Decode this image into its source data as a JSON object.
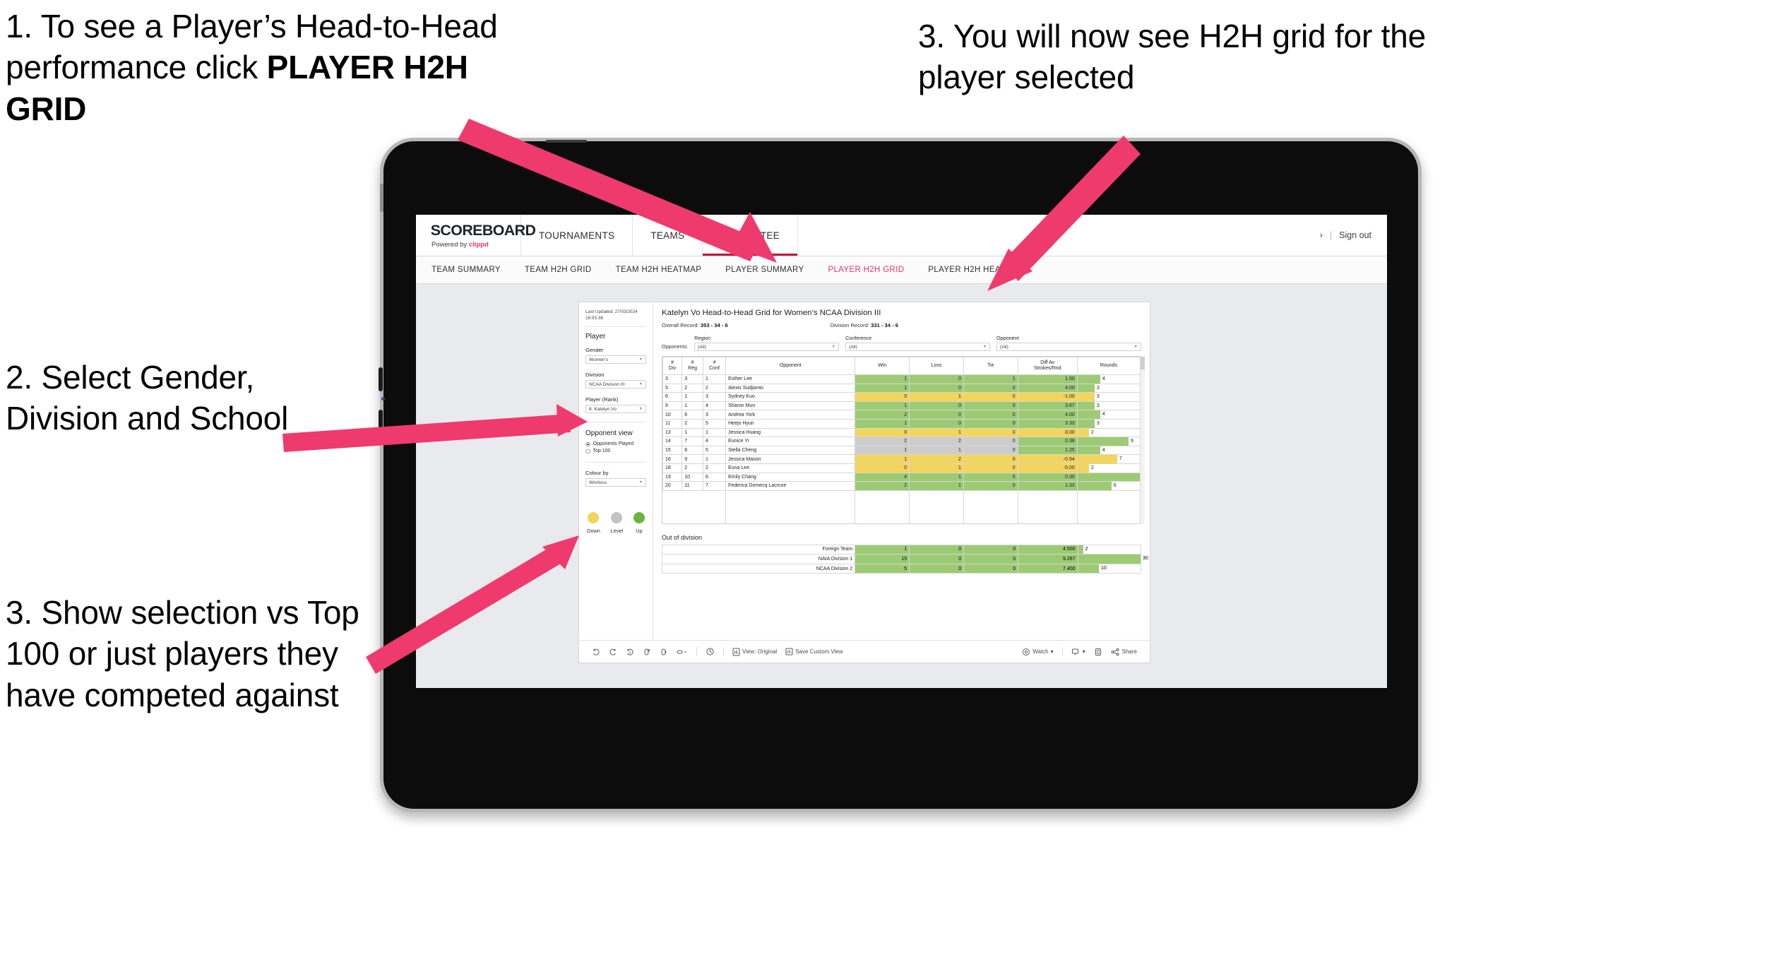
{
  "annotations": [
    {
      "id": "anno-1",
      "text_plain": "1. To see a Player’s Head-to-Head performance click ",
      "text_bold": "PLAYER H2H GRID"
    },
    {
      "id": "anno-2",
      "text": "2. Select Gender, Division and School"
    },
    {
      "id": "anno-3",
      "text": "3. Show selection vs Top 100 or just players they have competed against"
    },
    {
      "id": "anno-4",
      "text": "3. You will now see H2H grid for the player selected"
    }
  ],
  "colors": {
    "accent_pink": "#e8336d",
    "arrow_pink": "#ef3a6e",
    "win_green": "#9ccb74",
    "loss_yellow": "#f3d55b",
    "level_grey": "#cccccc",
    "active_tab_underline": "#c0143c"
  },
  "header": {
    "brand": "SCOREBOARD",
    "brand_sub_prefix": "Powered by ",
    "brand_sub_accent": "clippd",
    "nav": [
      {
        "label": "TOURNAMENTS",
        "active": false
      },
      {
        "label": "TEAMS",
        "active": false
      },
      {
        "label": "COMMITTEE",
        "active": true
      }
    ],
    "account_chevron": "›",
    "separator": "|",
    "sign_out": "Sign out"
  },
  "subnav": [
    {
      "label": "TEAM SUMMARY",
      "active": false
    },
    {
      "label": "TEAM H2H GRID",
      "active": false
    },
    {
      "label": "TEAM H2H HEATMAP",
      "active": false
    },
    {
      "label": "PLAYER SUMMARY",
      "active": false
    },
    {
      "label": "PLAYER H2H GRID",
      "active": true
    },
    {
      "label": "PLAYER H2H HEATMAP",
      "active": false
    }
  ],
  "sidebar": {
    "last_updated": "Last Updated: 27/03/2024 16:55:38",
    "section_player": "Player",
    "filters": [
      {
        "label": "Gender",
        "value": "Women's"
      },
      {
        "label": "Division",
        "value": "NCAA Division III"
      },
      {
        "label": "Player (Rank)",
        "value": "8. Katelyn Vo"
      }
    ],
    "opponent_view": {
      "title": "Opponent view",
      "options": [
        {
          "label": "Opponents Played",
          "selected": true
        },
        {
          "label": "Top 100",
          "selected": false
        }
      ]
    },
    "colour_by": {
      "label": "Colour by",
      "value": "Win/loss"
    },
    "legend": [
      {
        "label": "Down",
        "color": "#f3d55b"
      },
      {
        "label": "Level",
        "color": "#c2c2c2"
      },
      {
        "label": "Up",
        "color": "#6db33f"
      }
    ]
  },
  "main": {
    "title": "Katelyn Vo Head-to-Head Grid for Women’s NCAA Division III",
    "overall_record_label": "Overall Record: ",
    "overall_record_value": "353 -  34 - 6",
    "division_record_label": "Division Record: ",
    "division_record_value": "331 -  34 - 6",
    "opponents_label": "Opponents:",
    "opponent_filters": [
      {
        "label": "Region",
        "value": "(All)"
      },
      {
        "label": "Conference",
        "value": "(All)"
      },
      {
        "label": "Opponent",
        "value": "(All)"
      }
    ],
    "out_of_division_title": "Out of division"
  },
  "chart_data": {
    "type": "table",
    "title": "Katelyn Vo Head-to-Head Grid for Women’s NCAA Division III",
    "columns": [
      "# Div",
      "# Reg",
      "# Conf",
      "Opponent",
      "Win",
      "Loss",
      "Tie",
      "Diff Av Strokes/Rnd",
      "Rounds"
    ],
    "column_header_lines": [
      [
        "#",
        "Div"
      ],
      [
        "#",
        "Reg"
      ],
      [
        "#",
        "Conf"
      ],
      [
        "Opponent"
      ],
      [
        "Win"
      ],
      [
        "Loss"
      ],
      [
        "Tie"
      ],
      [
        "Diff Av",
        "Strokes/Rnd"
      ],
      [
        "Rounds"
      ]
    ],
    "rounds_max": 11,
    "rows": [
      {
        "div": "3",
        "reg": "3",
        "conf": "1",
        "opponent": "Esther Lee",
        "win": "1",
        "loss": "0",
        "tie": "1",
        "diff": "1.50",
        "rounds": 4,
        "state": "up"
      },
      {
        "div": "5",
        "reg": "2",
        "conf": "2",
        "opponent": "Alexis Sudjianto",
        "win": "1",
        "loss": "0",
        "tie": "0",
        "diff": "4.00",
        "rounds": 3,
        "state": "up"
      },
      {
        "div": "6",
        "reg": "1",
        "conf": "3",
        "opponent": "Sydney Kuo",
        "win": "0",
        "loss": "1",
        "tie": "0",
        "diff": "-1.00",
        "rounds": 3,
        "state": "down"
      },
      {
        "div": "9",
        "reg": "1",
        "conf": "4",
        "opponent": "Sharon Mun",
        "win": "1",
        "loss": "0",
        "tie": "0",
        "diff": "3.67",
        "rounds": 3,
        "state": "up"
      },
      {
        "div": "10",
        "reg": "6",
        "conf": "3",
        "opponent": "Andrea York",
        "win": "2",
        "loss": "0",
        "tie": "0",
        "diff": "4.00",
        "rounds": 4,
        "state": "up"
      },
      {
        "div": "11",
        "reg": "2",
        "conf": "5",
        "opponent": "Heejo Hyun",
        "win": "1",
        "loss": "0",
        "tie": "0",
        "diff": "3.33",
        "rounds": 3,
        "state": "up"
      },
      {
        "div": "13",
        "reg": "1",
        "conf": "1",
        "opponent": "Jessica Huang",
        "win": "0",
        "loss": "1",
        "tie": "0",
        "diff": "-3.00",
        "rounds": 2,
        "state": "down"
      },
      {
        "div": "14",
        "reg": "7",
        "conf": "4",
        "opponent": "Eunice Yi",
        "win": "2",
        "loss": "2",
        "tie": "0",
        "diff": "0.38",
        "rounds": 9,
        "state": "level",
        "diff_state": "up"
      },
      {
        "div": "15",
        "reg": "8",
        "conf": "5",
        "opponent": "Stella Cheng",
        "win": "1",
        "loss": "1",
        "tie": "0",
        "diff": "1.25",
        "rounds": 4,
        "state": "level",
        "diff_state": "up"
      },
      {
        "div": "16",
        "reg": "9",
        "conf": "1",
        "opponent": "Jessica Mason",
        "win": "1",
        "loss": "2",
        "tie": "0",
        "diff": "-0.94",
        "rounds": 7,
        "state": "down"
      },
      {
        "div": "18",
        "reg": "2",
        "conf": "2",
        "opponent": "Euna Lee",
        "win": "0",
        "loss": "1",
        "tie": "0",
        "diff": "-5.00",
        "rounds": 2,
        "state": "down"
      },
      {
        "div": "19",
        "reg": "10",
        "conf": "6",
        "opponent": "Emily Chang",
        "win": "4",
        "loss": "1",
        "tie": "0",
        "diff": "0.30",
        "rounds": 11,
        "state": "up"
      },
      {
        "div": "20",
        "reg": "11",
        "conf": "7",
        "opponent": "Federica Domecq Lacroze",
        "win": "2",
        "loss": "1",
        "tie": "0",
        "diff": "1.33",
        "rounds": 6,
        "state": "up"
      }
    ],
    "out_of_division": {
      "title": "Out of division",
      "rounds_max": 30,
      "rows": [
        {
          "name": "Foreign Team",
          "win": "1",
          "loss": "0",
          "tie": "0",
          "diff": "4.500",
          "rounds": 2,
          "state": "up"
        },
        {
          "name": "NAIA Division 1",
          "win": "15",
          "loss": "0",
          "tie": "0",
          "diff": "9.267",
          "rounds": 30,
          "state": "up"
        },
        {
          "name": "NCAA Division 2",
          "win": "5",
          "loss": "0",
          "tie": "0",
          "diff": "7.400",
          "rounds": 10,
          "state": "up"
        }
      ]
    }
  },
  "toolbar": {
    "view_original": "View: Original",
    "save_custom_view": "Save Custom View",
    "watch": "Watch",
    "share": "Share",
    "carat": "▾"
  }
}
